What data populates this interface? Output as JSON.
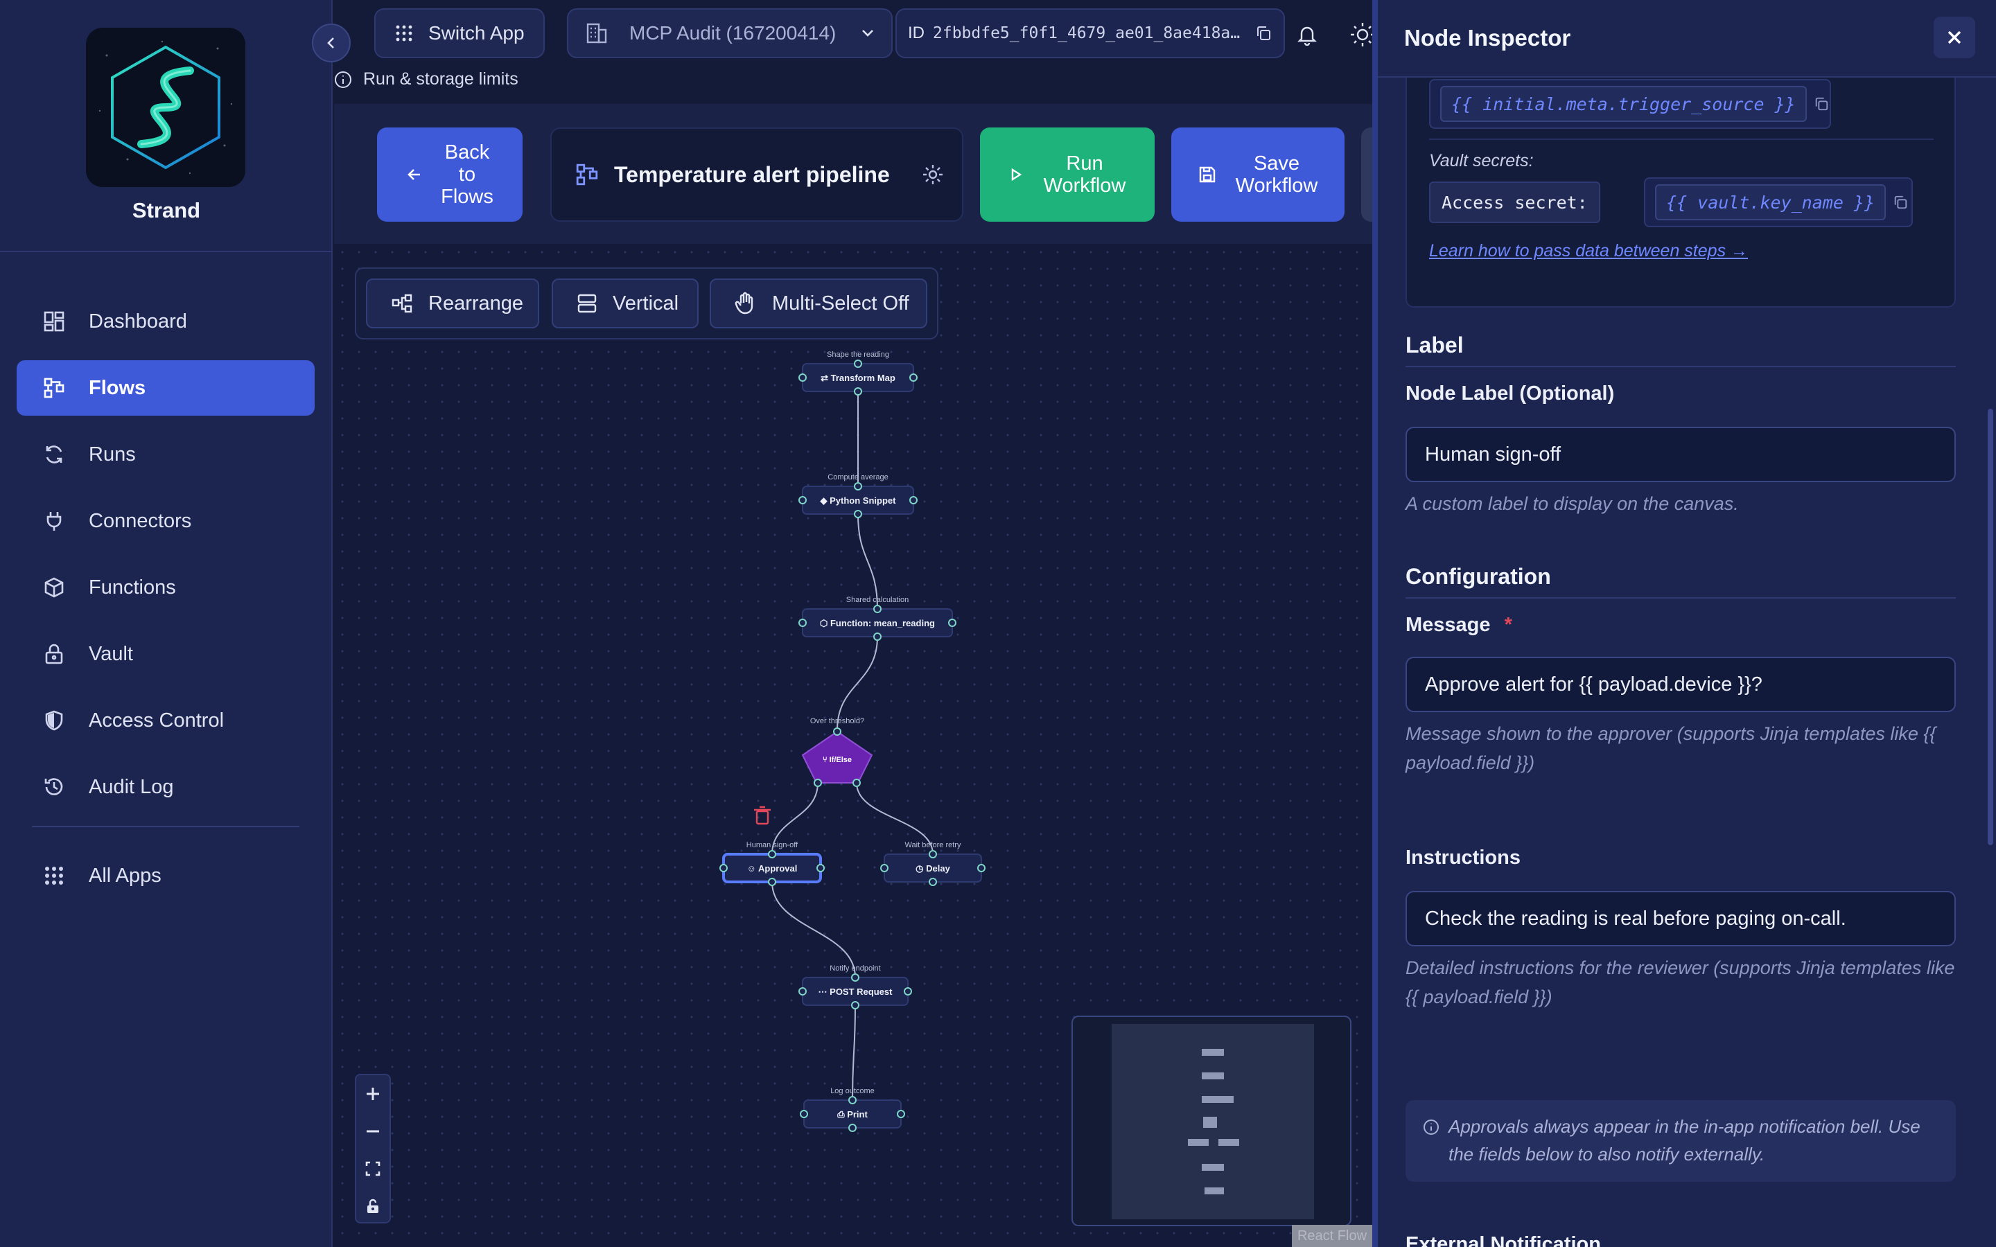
{
  "sidebar": {
    "brand_name": "Strand",
    "items": [
      {
        "label": "Dashboard",
        "icon": "dashboard-icon",
        "active": false
      },
      {
        "label": "Flows",
        "icon": "flows-icon",
        "active": true
      },
      {
        "label": "Runs",
        "icon": "runs-icon",
        "active": false
      },
      {
        "label": "Connectors",
        "icon": "plug-icon",
        "active": false
      },
      {
        "label": "Functions",
        "icon": "cube-icon",
        "active": false
      },
      {
        "label": "Vault",
        "icon": "lock-icon",
        "active": false
      },
      {
        "label": "Access Control",
        "icon": "shield-icon",
        "active": false
      },
      {
        "label": "Audit Log",
        "icon": "history-icon",
        "active": false
      }
    ],
    "all_apps": {
      "label": "All Apps",
      "icon": "grid-icon"
    }
  },
  "topbar": {
    "switch_app": "Switch App",
    "org_selector": "MCP Audit (167200414)",
    "id_label": "ID",
    "id_value": "2fbbdfe5_f0f1_4679_ae01_8ae418a…",
    "limits_link": "Run & storage limits"
  },
  "toolbar": {
    "back_label": "Back\nto\nFlows",
    "workflow_name": "Temperature alert pipeline",
    "run_label": "Run\nWorkflow",
    "save_label": "Save\nWorkflow"
  },
  "canvas_tools": {
    "rearrange": "Rearrange",
    "vertical": "Vertical",
    "multiselect": "Multi-Select Off"
  },
  "flow_nodes": [
    {
      "id": "n1",
      "caption": "Shape the reading",
      "label": "Transform Map",
      "icon": "transform-icon"
    },
    {
      "id": "n2",
      "caption": "Compute average",
      "label": "Python Snippet",
      "icon": "python-icon"
    },
    {
      "id": "n3",
      "caption": "Shared calculation",
      "label": "Function: mean_reading",
      "icon": "cube-icon"
    },
    {
      "id": "n4",
      "caption": "Over threshold?",
      "label": "If/Else",
      "icon": "branch-icon"
    },
    {
      "id": "n5",
      "caption": "Human sign-off",
      "label": "Approval",
      "icon": "user-check-icon",
      "selected": true
    },
    {
      "id": "n6",
      "caption": "Wait before retry",
      "label": "Delay",
      "icon": "clock-icon"
    },
    {
      "id": "n7",
      "caption": "Notify endpoint",
      "label": "POST Request",
      "icon": "http-icon"
    },
    {
      "id": "n8",
      "caption": "Log outcome",
      "label": "Print",
      "icon": "printer-icon"
    }
  ],
  "attribution": "React Flow",
  "inspector": {
    "title": "Node Inspector",
    "trigger_template": "{{ initial.meta.trigger_source }}",
    "vault_label": "Vault secrets:",
    "access_secret_label": "Access secret:",
    "vault_template": "{{ vault.key_name }}",
    "learn_link": "Learn how to pass data between steps →",
    "label_section": "Label",
    "node_label_title": "Node Label (Optional)",
    "node_label_value": "Human sign-off",
    "node_label_help": "A custom label to display on the canvas.",
    "config_section": "Configuration",
    "message_title": "Message",
    "required_mark": "*",
    "message_value": "Approve alert for {{ payload.device }}?",
    "message_help": "Message shown to the approver (supports Jinja templates like {{ payload.field }})",
    "instructions_title": "Instructions",
    "instructions_value": "Check the reading is real before paging on-call.",
    "instructions_help": "Detailed instructions for the reviewer (supports Jinja templates like {{ payload.field }})",
    "info_text": "Approvals always appear in the in-app notification bell. Use the fields below to also notify externally.",
    "external_heading": "External Notification"
  },
  "colors": {
    "accent": "#3f5ad8",
    "run_green": "#1fb37c",
    "ifelse_purple": "#6a23b0",
    "delete_red": "#e2475a"
  }
}
